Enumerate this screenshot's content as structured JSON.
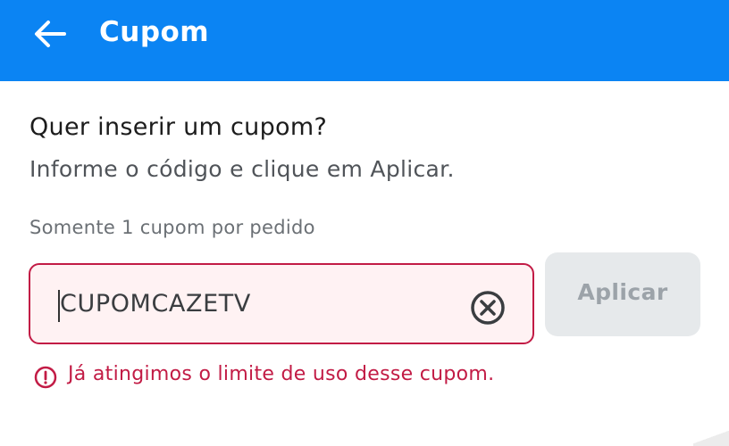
{
  "appbar": {
    "back_icon": "arrow-left-icon",
    "title": "Cupom",
    "background": "#0b84f3"
  },
  "content": {
    "heading": "Quer inserir um cupom?",
    "subheading": "Informe o código e clique em Aplicar.",
    "hint": "Somente 1 cupom por pedido"
  },
  "coupon_input": {
    "value": "CUPOMCAZETV",
    "clear_icon": "clear-circle-icon",
    "state": "error",
    "error_color": "#c21b45"
  },
  "apply_button": {
    "label": "Aplicar",
    "enabled": false
  },
  "error": {
    "icon": "alert-circle-icon",
    "message": "Já atingimos o limite de uso desse cupom."
  }
}
